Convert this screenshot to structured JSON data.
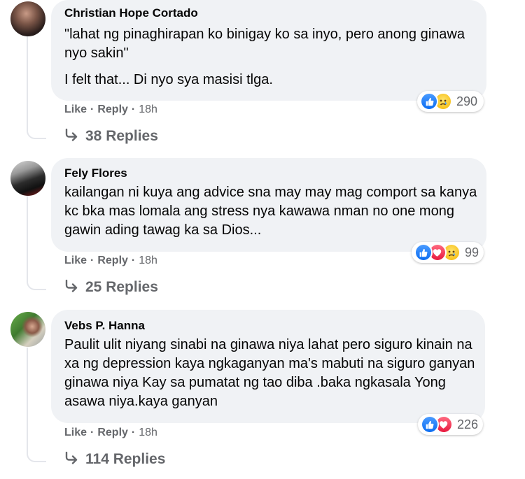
{
  "comments": [
    {
      "author": "Christian Hope Cortado",
      "paragraphs": [
        "\"lahat ng pinaghirapan ko binigay ko sa inyo, pero anong ginawa nyo sakin\"",
        "I felt that... Di nyo sya masisi tlga."
      ],
      "reactions": [
        "like",
        "sad"
      ],
      "reaction_count": "290",
      "like_label": "Like",
      "reply_label": "Reply",
      "time": "18h",
      "replies_label": "38 Replies"
    },
    {
      "author": "Fely Flores",
      "paragraphs": [
        "kailangan ni kuya ang advice sna may may mag comport sa kanya kc bka mas lomala ang stress nya kawawa nman no one mong gawin ading tawag ka sa Dios..."
      ],
      "reactions": [
        "like",
        "love",
        "sad"
      ],
      "reaction_count": "99",
      "like_label": "Like",
      "reply_label": "Reply",
      "time": "18h",
      "replies_label": "25 Replies"
    },
    {
      "author": "Vebs P. Hanna",
      "paragraphs": [
        "Paulit ulit niyang sinabi na ginawa niya lahat pero siguro kinain na xa ng depression kaya ngkaganyan ma's mabuti na siguro ganyan ginawa niya Kay sa pumatat ng tao diba .baka ngkasala Yong asawa niya.kaya ganyan"
      ],
      "reactions": [
        "like",
        "love"
      ],
      "reaction_count": "226",
      "like_label": "Like",
      "reply_label": "Reply",
      "time": "18h",
      "replies_label": "114 Replies"
    }
  ],
  "separator": "·",
  "colors": {
    "bubble": "#f0f2f5",
    "secondary_text": "#65676b",
    "like_blue": "#1877f2",
    "love_red": "#f33e58",
    "sad_yellow": "#f7b125"
  }
}
